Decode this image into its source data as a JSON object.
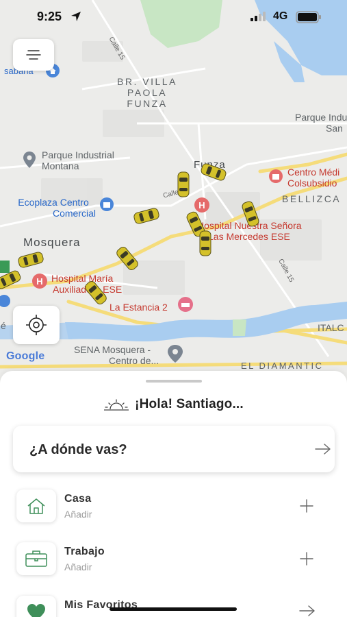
{
  "status_bar": {
    "time": "9:25",
    "network": "4G"
  },
  "map": {
    "labels": {
      "sabana": "sabana",
      "calle15_top": "Calle 15",
      "br_villa_1": "BR. VILLA",
      "br_villa_2": "PAOLA",
      "br_villa_3": "FUNZA",
      "parque_ind_right_1": "Parque Indu",
      "parque_ind_right_2": "San",
      "parque_montana_1": "Parque Industrial",
      "parque_montana_2": "Montana",
      "funza": "Funza",
      "centro_medico_1": "Centro Médi",
      "centro_medico_2": "Colsubsidio",
      "calle13": "Calle 13",
      "bellizca": "BELLIZCA",
      "ecoplaza_1": "Ecoplaza Centro",
      "ecoplaza_2": "Comercial",
      "hospital_funza_1": "Hospital Nuestra Señora",
      "hospital_funza_2": "Las Mercedes ESE",
      "mosquera": "Mosquera",
      "calle15_bottom": "Calle 15",
      "hospital_maria_1": "Hospital María",
      "hospital_maria_2": "Auxiliadora ESE",
      "la_estancia": "La Estancia 2",
      "italc": "ITALC",
      "sena_1": "SENA Mosquera -",
      "sena_2": "Centro de...",
      "el_diamante": "EL DIAMANTIC",
      "edge_e": "é"
    },
    "google_logo": "Google",
    "taxi_count_icon": "taxi-icon"
  },
  "buttons": {
    "menu_icon": "menu-icon",
    "locate_icon": "crosshair-icon"
  },
  "sheet": {
    "greeting": "¡Hola! Santiago...",
    "greeting_icon": "sunrise-icon",
    "search_prompt": "¿A dónde vas?",
    "places": [
      {
        "title": "Casa",
        "subtitle": "Añadir",
        "icon": "home-icon",
        "action_icon": "plus-icon"
      },
      {
        "title": "Trabajo",
        "subtitle": "Añadir",
        "icon": "briefcase-icon",
        "action_icon": "plus-icon"
      },
      {
        "title": "Mis Favoritos",
        "subtitle": "",
        "icon": "heart-icon",
        "action_icon": "arrow-right-icon"
      }
    ]
  },
  "colors": {
    "accent_green": "#3f8f5a",
    "taxi_yellow": "#d4c12a",
    "road_yellow": "#f5dc7a",
    "water_blue": "#a9cdf0",
    "park_green": "#c8e6c4"
  }
}
